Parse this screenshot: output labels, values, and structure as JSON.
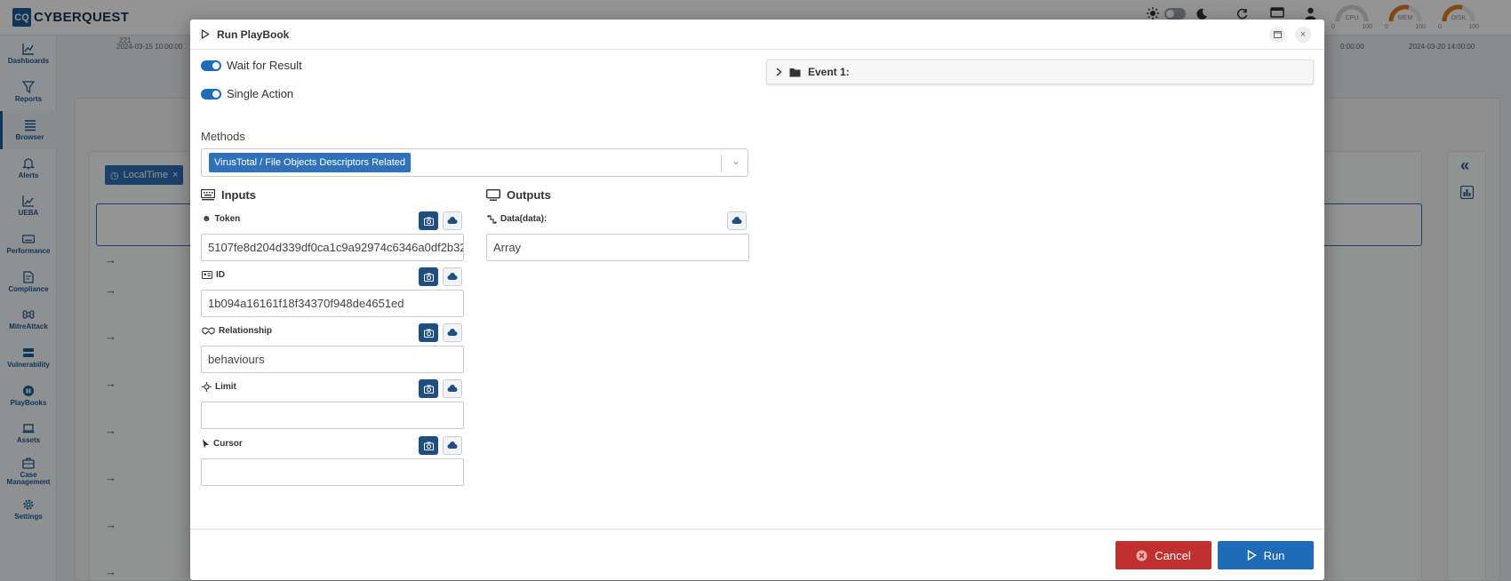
{
  "app": {
    "logo_mark": "CQ",
    "logo_text": "CYBERQUEST",
    "gauges": [
      {
        "label": "CPU",
        "min": "0",
        "max": "100",
        "level": 0.05,
        "color": "#cccccc"
      },
      {
        "label": "MEM",
        "min": "0",
        "max": "100",
        "level": 0.55,
        "color": "#e07a1f"
      },
      {
        "label": "DISK",
        "min": "0",
        "max": "100",
        "level": 0.55,
        "color": "#e07a1f"
      }
    ]
  },
  "sidebar": {
    "items": [
      {
        "label": "Dashboards",
        "icon": "chart-icon"
      },
      {
        "label": "Reports",
        "icon": "filter-icon"
      },
      {
        "label": "Browser",
        "icon": "list-icon"
      },
      {
        "label": "Alerts",
        "icon": "bell-icon"
      },
      {
        "label": "UEBA",
        "icon": "line-chart-icon"
      },
      {
        "label": "Performance",
        "icon": "keyboard-icon"
      },
      {
        "label": "Compliance",
        "icon": "document-icon"
      },
      {
        "label": "MitreAttack",
        "icon": "command-icon"
      },
      {
        "label": "Vulnerability",
        "icon": "server-icon"
      },
      {
        "label": "PlayBooks",
        "icon": "playbook-icon"
      },
      {
        "label": "Assets",
        "icon": "laptop-icon"
      },
      {
        "label": "Case Management",
        "icon": "briefcase-icon"
      },
      {
        "label": "Settings",
        "icon": "gear-icon"
      }
    ]
  },
  "background": {
    "axis_left_value": "221",
    "axis_left_date": "2024-03-15 10:00:00",
    "axis_mid_date": "0:00:00",
    "axis_right_date": "2024-03-20 14:00:00",
    "time_chip": "LocalTime"
  },
  "modal": {
    "title": "Run PlayBook",
    "wait_for_result": {
      "label": "Wait for Result",
      "checked": true
    },
    "single_action": {
      "label": "Single Action",
      "checked": true
    },
    "methods_label": "Methods",
    "selected_method": "VirusTotal / File Objects Descriptors Related",
    "inputs_title": "Inputs",
    "outputs_title": "Outputs",
    "inputs": [
      {
        "label": "Token",
        "value": "5107fe8d204d339df0ca1c9a92974c6346a0df2b32",
        "icon": "token-icon"
      },
      {
        "label": "ID",
        "value": "1b094a16161f18f34370f948de4651ed",
        "icon": "id-card-icon"
      },
      {
        "label": "Relationship",
        "value": "behaviours",
        "icon": "handshake-icon"
      },
      {
        "label": "Limit",
        "value": "",
        "icon": "limit-icon"
      },
      {
        "label": "Cursor",
        "value": "",
        "icon": "cursor-icon"
      }
    ],
    "outputs": [
      {
        "label": "Data(data):",
        "value": "Array",
        "icon": "link-icon"
      }
    ],
    "event_title": "Event 1:",
    "cancel_label": "Cancel",
    "run_label": "Run"
  }
}
